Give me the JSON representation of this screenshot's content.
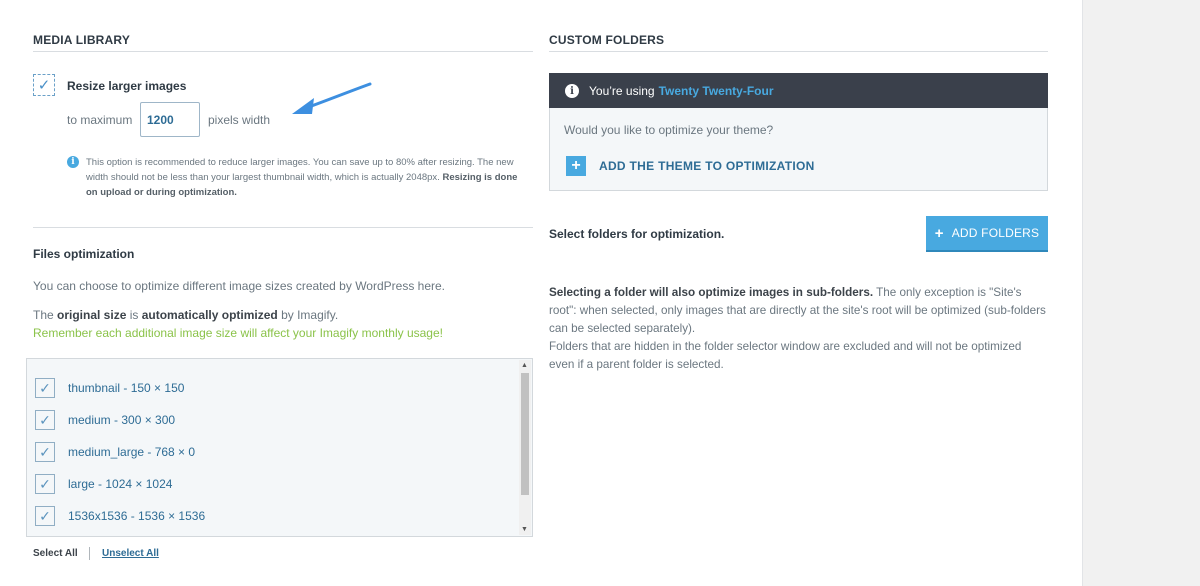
{
  "media_library": {
    "title": "MEDIA LIBRARY",
    "resize": {
      "label": "Resize larger images",
      "to_maximum": "to maximum",
      "width_value": "1200",
      "pixels_width": "pixels width"
    },
    "note": {
      "text": "This option is recommended to reduce larger images. You can save up to 80% after resizing. The new width should not be less than your largest thumbnail width, which is actually 2048px. ",
      "bold": "Resizing is done on upload or during optimization."
    }
  },
  "files_optimization": {
    "title": "Files optimization",
    "p1": "You can choose to optimize different image sizes created by WordPress here.",
    "p2": {
      "a": "The ",
      "b": "original size",
      "c": " is ",
      "d": "automatically optimized",
      "e": " by Imagify."
    },
    "p3": "Remember each additional image size will affect your Imagify monthly usage!",
    "sizes": [
      {
        "label": "thumbnail - 150 × 150"
      },
      {
        "label": "medium - 300 × 300"
      },
      {
        "label": "medium_large - 768 × 0"
      },
      {
        "label": "large - 1024 × 1024"
      },
      {
        "label": "1536x1536 - 1536 × 1536"
      }
    ],
    "select_all": "Select All",
    "unselect_all": "Unselect All"
  },
  "custom_folders": {
    "title": "CUSTOM FOLDERS",
    "theme_bar": {
      "prefix": "You’re using",
      "theme_name": "Twenty Twenty-Four"
    },
    "theme_question": "Would you like to optimize your theme?",
    "add_theme": "ADD THE THEME TO OPTIMIZATION",
    "select_folders": "Select folders for optimization.",
    "add_folders": "ADD FOLDERS",
    "description": {
      "bold": "Selecting a folder will also optimize images in sub-folders.",
      "rest": " The only exception is \"Site's root\": when selected, only images that are directly at the site's root will be optimized (sub-folders can be selected separately).",
      "line2": "Folders that are hidden in the folder selector window are excluded and will not be optimized even if a parent folder is selected."
    }
  },
  "colors": {
    "accent": "#48a9e0",
    "link": "#2e6c95",
    "warning_green": "#8bc34a",
    "dark_bar": "#3a404b"
  },
  "icons": {
    "info": "info-icon",
    "plus": "plus-icon",
    "check": "checkmark-icon",
    "arrow": "arrow-pointer-icon"
  }
}
